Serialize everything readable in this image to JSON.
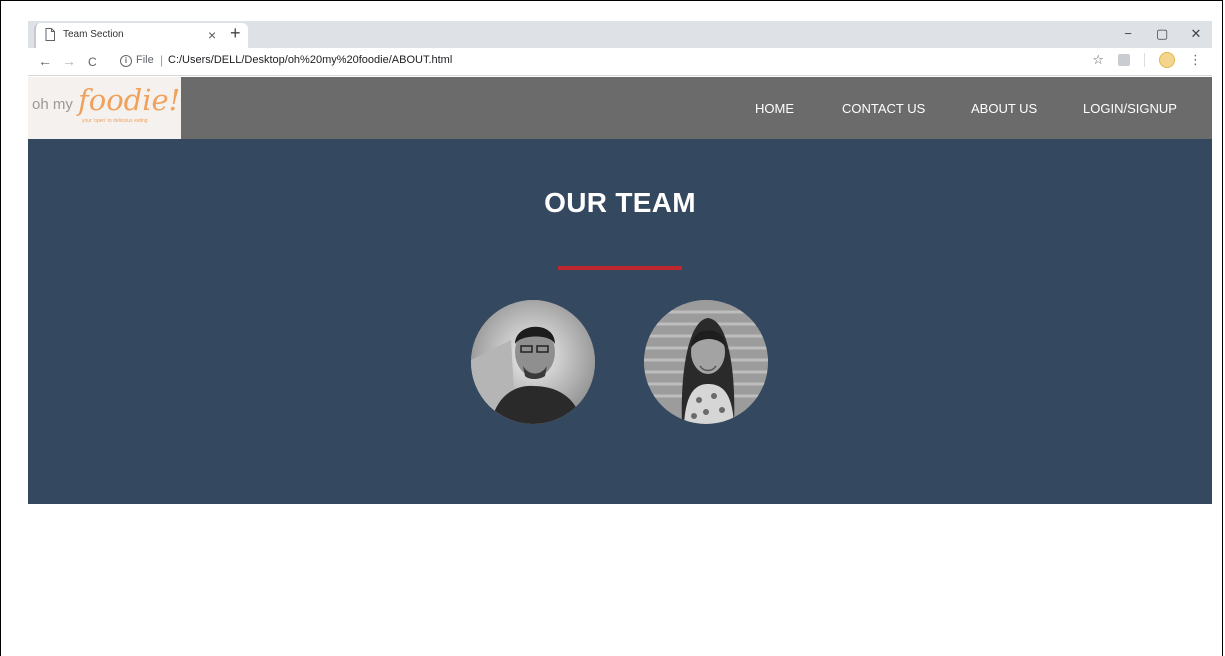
{
  "browser": {
    "tab_title": "Team Section",
    "tab_close": "×",
    "new_tab": "+",
    "controls": {
      "minimize": "−",
      "restore": "▢",
      "close": "✕"
    },
    "back": "←",
    "forward": "→",
    "reload": "C",
    "info": "i",
    "file_label": "File",
    "separator": "|",
    "url": "C:/Users/DELL/Desktop/oh%20my%20foodie/ABOUT.html",
    "star": "☆",
    "menu": "⋮"
  },
  "site": {
    "logo": {
      "prefix": "oh my",
      "brand": "foodie!",
      "tagline": "your 'open' to delicious eating"
    },
    "nav": [
      "HOME",
      "CONTACT US",
      "ABOUT US",
      "LOGIN/SIGNUP"
    ]
  },
  "hero": {
    "title": "OUR TEAM"
  },
  "colors": {
    "header_bg": "#6b6b6b",
    "hero_bg": "#34485f",
    "accent": "#c0262d",
    "logo_orange": "#f0a15c"
  },
  "icons": [
    "file-icon",
    "back-icon",
    "forward-icon",
    "reload-icon",
    "info-icon",
    "star-icon",
    "extension-icon",
    "profile-icon",
    "menu-icon"
  ]
}
